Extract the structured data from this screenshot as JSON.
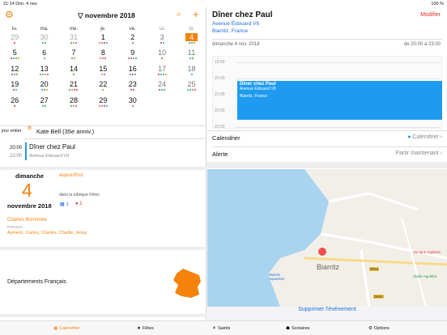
{
  "status": {
    "time": "21:14",
    "date": "Dim. 4 nov.",
    "battery": "100 %"
  },
  "calendar": {
    "month": "▽ novembre 2018",
    "weekdays": [
      "lu.",
      "ma.",
      "me.",
      "je.",
      "ve.",
      "sa.",
      "di."
    ],
    "weeks": [
      [
        "29",
        "30",
        "31",
        "1",
        "2",
        "3",
        "4"
      ],
      [
        "5",
        "6",
        "7",
        "8",
        "9",
        "10",
        "11"
      ],
      [
        "12",
        "13",
        "14",
        "15",
        "16",
        "17",
        "18"
      ],
      [
        "19",
        "20",
        "21",
        "22",
        "23",
        "24",
        "25"
      ],
      [
        "26",
        "27",
        "28",
        "29",
        "30",
        "",
        ""
      ]
    ]
  },
  "events": {
    "allday_label": "jour entier",
    "birthday": "Kate Bell (35e anniv.)",
    "time1": "20:00",
    "time2": "22:00",
    "ev_title": "Dîner chez Paul",
    "ev_sub": "Avenue Édouard VII"
  },
  "today": {
    "weekday": "dimanche",
    "link": "aujourd'hui",
    "daynum": "4",
    "rubric": "dans la rubrique Fêtes",
    "monthyear": "novembre 2018",
    "count1": "1",
    "count2": "1",
    "saint": "Charles Borromée",
    "prenoms_label": "Prénoms :",
    "prenoms": "Aymeric, Carlos, Charles, Charlie, Jessy"
  },
  "dept": {
    "label": "Départements Français"
  },
  "detail": {
    "title": "Dîner chez Paul",
    "modify": "Modifier",
    "addr1": "Avenue Édouard VII",
    "addr2": "Biarritz, France",
    "date": "dimanche 4 nov. 2018",
    "range": "de 20:00 à 23:00",
    "hours": [
      "19:00",
      "20:00",
      "21:00",
      "22:00",
      "23:00"
    ],
    "block_title": "Dîner chez Paul",
    "block_l1": "Avenue Édouard VII",
    "block_l2": "Biarritz, France",
    "cal_label": "Calendrier",
    "cal_value": "Calendrier",
    "alert_label": "Alerte",
    "alert_value": "Partir maintenant",
    "delete": "Supprimer l'événement"
  },
  "map": {
    "city": "Biarritz",
    "aquarium": "Biarritz Aquarium",
    "clinic": "Clinique Aguilera",
    "stade": "Stade Aguiléra",
    "road1": "D911",
    "road2": "D810"
  },
  "tabs": [
    "Calendrier",
    "Fêtes",
    "Saints",
    "Scolaires",
    "Options"
  ]
}
